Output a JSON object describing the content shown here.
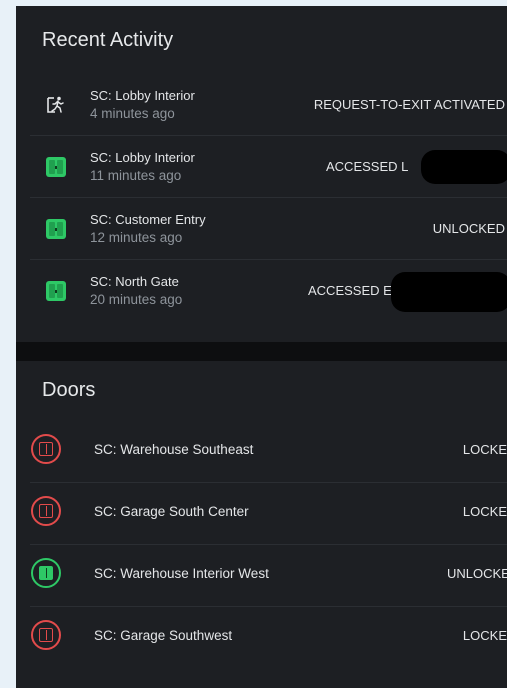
{
  "recent_activity": {
    "title": "Recent Activity",
    "items": [
      {
        "icon": "exit-running-person-icon",
        "name": "SC: Lobby Interior",
        "time": "4 minutes ago",
        "status": "REQUEST-TO-EXIT ACTIVATED"
      },
      {
        "icon": "door-open-icon",
        "name": "SC: Lobby Interior",
        "time": "11 minutes ago",
        "status": "ACCESSED L"
      },
      {
        "icon": "door-open-icon",
        "name": "SC: Customer Entry",
        "time": "12 minutes ago",
        "status": "UNLOCKED"
      },
      {
        "icon": "door-open-icon",
        "name": "SC: North Gate",
        "time": "20 minutes ago",
        "status": "ACCESSED E"
      }
    ]
  },
  "doors": {
    "title": "Doors",
    "items": [
      {
        "name": "SC: Warehouse Southeast",
        "status": "LOCKE",
        "state": "locked"
      },
      {
        "name": "SC: Garage South Center",
        "status": "LOCKE",
        "state": "locked"
      },
      {
        "name": "SC: Warehouse Interior West",
        "status": "UNLOCKE",
        "state": "unlocked"
      },
      {
        "name": "SC: Garage Southwest",
        "status": "LOCKE",
        "state": "locked"
      }
    ]
  },
  "colors": {
    "locked": "#e24b4b",
    "unlocked": "#2ec866",
    "card_bg": "#1d1f23"
  }
}
